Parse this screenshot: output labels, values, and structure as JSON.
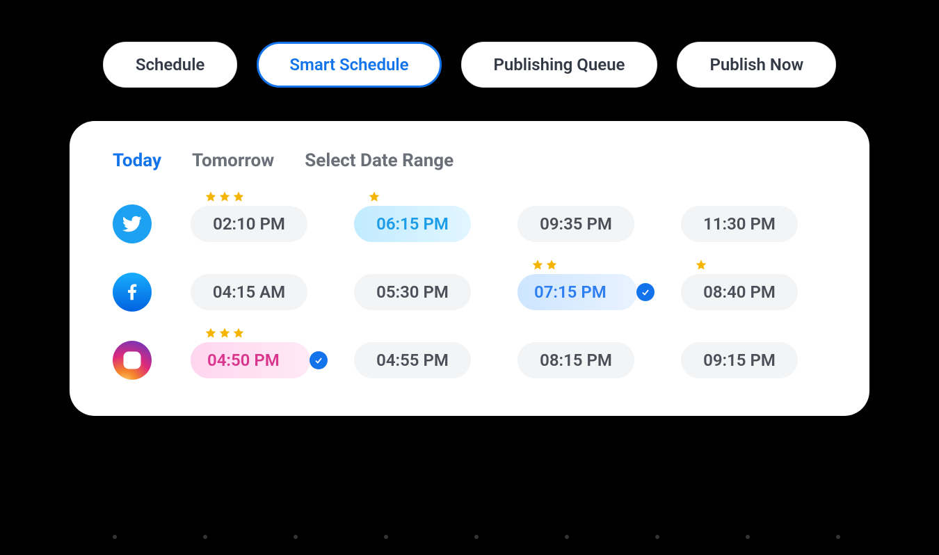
{
  "tabs": {
    "schedule": "Schedule",
    "smart": "Smart Schedule",
    "queue": "Publishing Queue",
    "now": "Publish Now"
  },
  "date_tabs": {
    "today": "Today",
    "tomorrow": "Tomorrow",
    "range": "Select Date Range"
  },
  "rows": {
    "twitter": {
      "s0": {
        "time": "02:10 PM",
        "stars": 3
      },
      "s1": {
        "time": "06:15 PM",
        "stars": 1
      },
      "s2": {
        "time": "09:35 PM",
        "stars": 0
      },
      "s3": {
        "time": "11:30 PM",
        "stars": 0
      }
    },
    "facebook": {
      "s0": {
        "time": "04:15 AM",
        "stars": 0
      },
      "s1": {
        "time": "05:30 PM",
        "stars": 0
      },
      "s2": {
        "time": "07:15 PM",
        "stars": 2
      },
      "s3": {
        "time": "08:40 PM",
        "stars": 1
      }
    },
    "instagram": {
      "s0": {
        "time": "04:50 PM",
        "stars": 3
      },
      "s1": {
        "time": "04:55 PM",
        "stars": 0
      },
      "s2": {
        "time": "08:15 PM",
        "stars": 0
      },
      "s3": {
        "time": "09:15 PM",
        "stars": 0
      }
    }
  }
}
